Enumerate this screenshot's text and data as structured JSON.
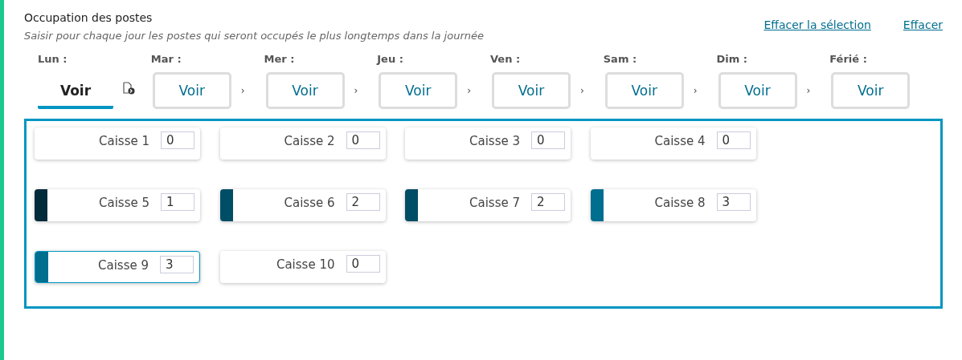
{
  "header": {
    "title": "Occupation des postes",
    "subtitle": "Saisir pour chaque jour les postes qui seront occupés le plus longtemps dans la journée",
    "links": [
      "Effacer la sélection",
      "Effacer"
    ]
  },
  "days": [
    {
      "label": "Lun :",
      "button": "Voir",
      "selected": true
    },
    {
      "label": "Mar :",
      "button": "Voir",
      "selected": false
    },
    {
      "label": "Mer :",
      "button": "Voir",
      "selected": false
    },
    {
      "label": "Jeu :",
      "button": "Voir",
      "selected": false
    },
    {
      "label": "Ven :",
      "button": "Voir",
      "selected": false
    },
    {
      "label": "Sam :",
      "button": "Voir",
      "selected": false
    },
    {
      "label": "Dim :",
      "button": "Voir",
      "selected": false
    },
    {
      "label": "Férié :",
      "button": "Voir",
      "selected": false
    }
  ],
  "separator": "›",
  "stations": [
    {
      "name": "Caisse 1",
      "value": "0",
      "selected": false
    },
    {
      "name": "Caisse 2",
      "value": "0",
      "selected": false
    },
    {
      "name": "Caisse 3",
      "value": "0",
      "selected": false
    },
    {
      "name": "Caisse 4",
      "value": "0",
      "selected": false
    },
    {
      "name": "Caisse 5",
      "value": "1",
      "color": "#002b3b",
      "selected": false
    },
    {
      "name": "Caisse 6",
      "value": "2",
      "color": "#004d66",
      "selected": false
    },
    {
      "name": "Caisse 7",
      "value": "2",
      "color": "#004d66",
      "selected": false
    },
    {
      "name": "Caisse 8",
      "value": "3",
      "color": "#006e8f",
      "selected": false
    },
    {
      "name": "Caisse 9",
      "value": "3",
      "color": "#006e8f",
      "selected": true
    },
    {
      "name": "Caisse 10",
      "value": "0",
      "selected": false
    }
  ]
}
